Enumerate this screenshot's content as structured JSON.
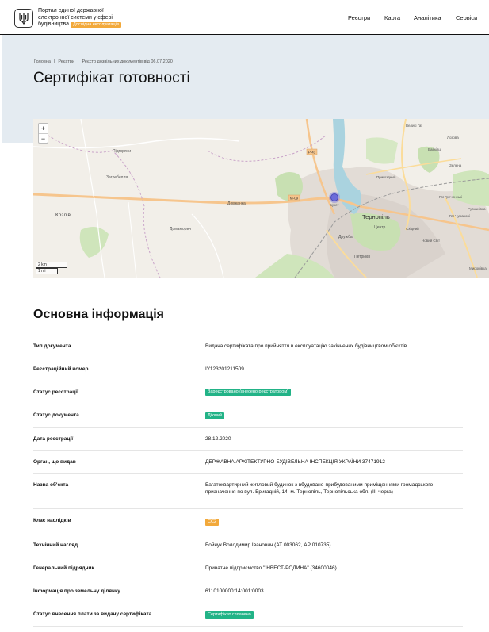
{
  "header": {
    "brand_line1": "Портал єдиної державної",
    "brand_line2": "електронної системи у сфері",
    "brand_line3": "будівництва",
    "test_badge": "Дослідна експлуатація",
    "nav": [
      "Реєстри",
      "Карта",
      "Аналітика",
      "Сервіси"
    ]
  },
  "breadcrumb": {
    "home": "Головна",
    "registries": "Реєстри",
    "current": "Реєстр дозвільних документів від 06.07.2020"
  },
  "page_title": "Сертифікат готовності",
  "map": {
    "zoom_in": "+",
    "zoom_out": "−",
    "scale_km": "2 km",
    "scale_mi": "1 mi",
    "labels": {
      "pidhoryany": "Підгоряни",
      "zahrebellya": "Загребелля",
      "kozliv": "Козлів",
      "dovzhanka": "Довжанка",
      "domamoryts": "Домаморич",
      "ternopil": "Тернопіль",
      "bukets": "Букет",
      "druzhba": "Дружба",
      "tsentr": "Центр",
      "petrykiv": "Петриків",
      "velyki_hayi": "Великі Гаї",
      "baykivtsi": "Байківці",
      "lozova": "Лозова",
      "r41": "Р-41",
      "m09": "М-09",
      "prybuzha": "Пригоздний",
      "skhidny": "Східний",
      "novyi_svit": "Новий Світ",
      "zelena": "Зелена",
      "hai_chumakovy": "Гаї Чумакові",
      "hai_hretskovi": "Гаї Гречинські",
      "ruskanivka": "Русканівка",
      "myrone": "Миронівка"
    }
  },
  "section_title": "Основна інформація",
  "rows": [
    {
      "label": "Тип документа",
      "value": "Видача сертифіката про прийняття в експлуатацію закінчених будівництвом об'єктів"
    },
    {
      "label": "Реєстраційний номер",
      "value": "ІУ123201211509"
    },
    {
      "label": "Статус реєстрації",
      "chip": "Зареєстровано (внесено реєстратором)",
      "chip_color": "#22b387"
    },
    {
      "label": "Статус документа",
      "chip": "Діючий",
      "chip_color": "#22b387"
    },
    {
      "label": "Дата реєстрації",
      "value": "28.12.2020"
    },
    {
      "label": "Орган, що видав",
      "value": "ДЕРЖАВНА АРХІТЕКТУРНО-БУДІВЕЛЬНА ІНСПЕКЦІЯ УКРАЇНИ 37471912"
    },
    {
      "label": "Назва об'єкта",
      "value": "Багатоквартирний житловий будинок з вбудовано-прибудованими приміщеннями громадського призначення по вул. Бригадній, 14, м. Тернопіль, Тернопільська обл. (ІІІ черга)"
    },
    {
      "label": "Клас наслідків",
      "chip": "СС2",
      "chip_color": "#f2a93b"
    },
    {
      "label": "Технічний нагляд",
      "value": "Бойчук Володимир Іванович (АТ 003062, АР 010735)"
    },
    {
      "label": "Генеральний підрядник",
      "value": "Приватне підприємство \"ІНВЕСТ-РОДИНА\" (34600046)"
    },
    {
      "label": "Інформація про земельну ділянку",
      "value": "6110100000:14:001:0003"
    },
    {
      "label": "Статус внесення плати за видачу сертифіката",
      "chip": "Сертифікат сплачено",
      "chip_color": "#22b387"
    }
  ]
}
